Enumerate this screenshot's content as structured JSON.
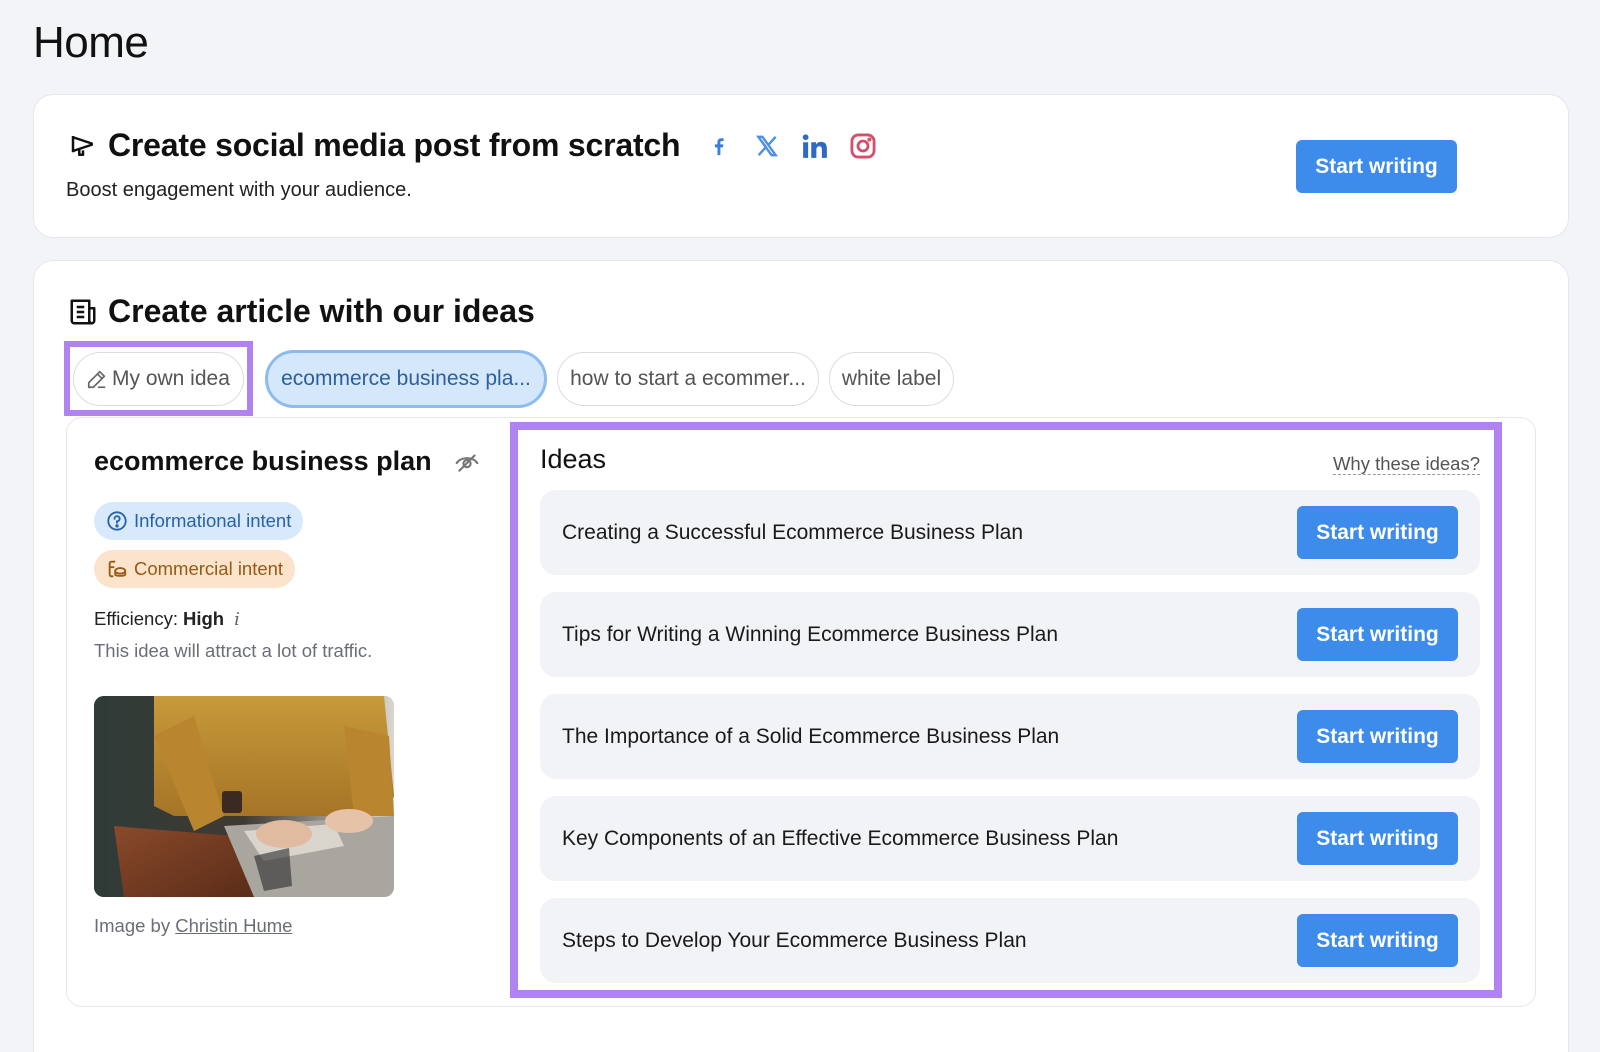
{
  "page": {
    "title": "Home"
  },
  "social_card": {
    "title": "Create social media post from scratch",
    "subtitle": "Boost engagement with your audience.",
    "icons": [
      "facebook-icon",
      "x-twitter-icon",
      "linkedin-icon",
      "instagram-icon"
    ],
    "button_label": "Start writing"
  },
  "article_card": {
    "title": "Create article with our ideas",
    "chips": [
      {
        "label": "My own idea",
        "icon": "pencil-icon",
        "active": false
      },
      {
        "label": "ecommerce business pla...",
        "active": true
      },
      {
        "label": "how to start a ecommer...",
        "active": false
      },
      {
        "label": "white label",
        "active": false
      }
    ],
    "keyword": {
      "title": "ecommerce business plan",
      "badges": [
        {
          "label": "Informational intent",
          "icon": "question-circle-icon"
        },
        {
          "label": "Commercial intent",
          "icon": "coins-icon"
        }
      ],
      "efficiency_label": "Efficiency:",
      "efficiency_value": "High",
      "efficiency_info": "i",
      "efficiency_desc": "This idea will attract a lot of traffic.",
      "image_credit_prefix": "Image by",
      "image_credit_author": "Christin Hume"
    },
    "ideas": {
      "heading": "Ideas",
      "why_link": "Why these ideas?",
      "items": [
        {
          "title": "Creating a Successful Ecommerce Business Plan",
          "button": "Start writing"
        },
        {
          "title": "Tips for Writing a Winning Ecommerce Business Plan",
          "button": "Start writing"
        },
        {
          "title": "The Importance of a Solid Ecommerce Business Plan",
          "button": "Start writing"
        },
        {
          "title": "Key Components of an Effective Ecommerce Business Plan",
          "button": "Start writing"
        },
        {
          "title": "Steps to Develop Your Ecommerce Business Plan",
          "button": "Start writing"
        }
      ]
    }
  },
  "colors": {
    "primary": "#3d8bea",
    "highlight": "#b083f0",
    "info_badge_bg": "#d7e9fb",
    "commercial_badge_bg": "#fbe3cc",
    "facebook": "#3b7de0",
    "x": "#4f8fe0",
    "linkedin": "#2f6ac2",
    "instagram": "#d4506a"
  }
}
